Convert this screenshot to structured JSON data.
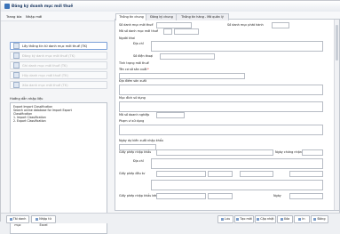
{
  "window": {
    "title": "Đăng ký doanh mục mới thuế"
  },
  "menu": {
    "items": [
      "Trang bìa",
      "Nhập mới"
    ]
  },
  "sidebar": {
    "actions": [
      {
        "label": "Lấy thông tin từ danh mục mới thuế (TK)",
        "state": "active"
      },
      {
        "label": "Đăng ký danh mục mới thuế (TK)",
        "state": "disabled"
      },
      {
        "label": "Ghi danh mục mới thuế (TK)",
        "state": "disabled"
      },
      {
        "label": "Hủy danh mục mới thuế (TK)",
        "state": "disabled"
      },
      {
        "label": "Xóa danh mục mới thuế (TK)",
        "state": "disabled"
      }
    ],
    "notes_label": "Hướng dẫn nhập liệu",
    "notes_lines": [
      "Export Import Classification",
      "Search online database for Import Export",
      "Classification",
      "1. Import Classification",
      "2. Export Classification"
    ]
  },
  "tabs": [
    "Thông tin chung",
    "Đăng ký chung",
    "Thông tin hàng - Mã quản lý"
  ],
  "form": {
    "labels": [
      "Số danh mục mới thuế",
      "Số danh mục phát hành",
      "Mã số danh mục mới thuế",
      "Người khai",
      "Địa chỉ",
      "Số điện thoại",
      "Tình trạng mới thuế",
      "Tên cơ sở sản xuất",
      "Địa điểm sản xuất",
      "Mục đích sử dụng",
      "Mã số doanh nghiệp",
      "Phạm vi sử dụng",
      "Ngày dự kiến xuất nhập khẩu",
      "Giấy phép nhập khẩu",
      "Ngày chứng nhận",
      "Địa chỉ",
      "Giấy phép đầu tư",
      "Giấy phép nhập khẩu kèm theo",
      "Ngày"
    ]
  },
  "status_bar": {
    "left_buttons": [
      "Tải danh mục",
      "Nhập từ Excel"
    ],
    "right_buttons": [
      "Lưu",
      "Tạo mới",
      "Cập nhật",
      "Xóa",
      "In",
      "Đóng"
    ]
  }
}
